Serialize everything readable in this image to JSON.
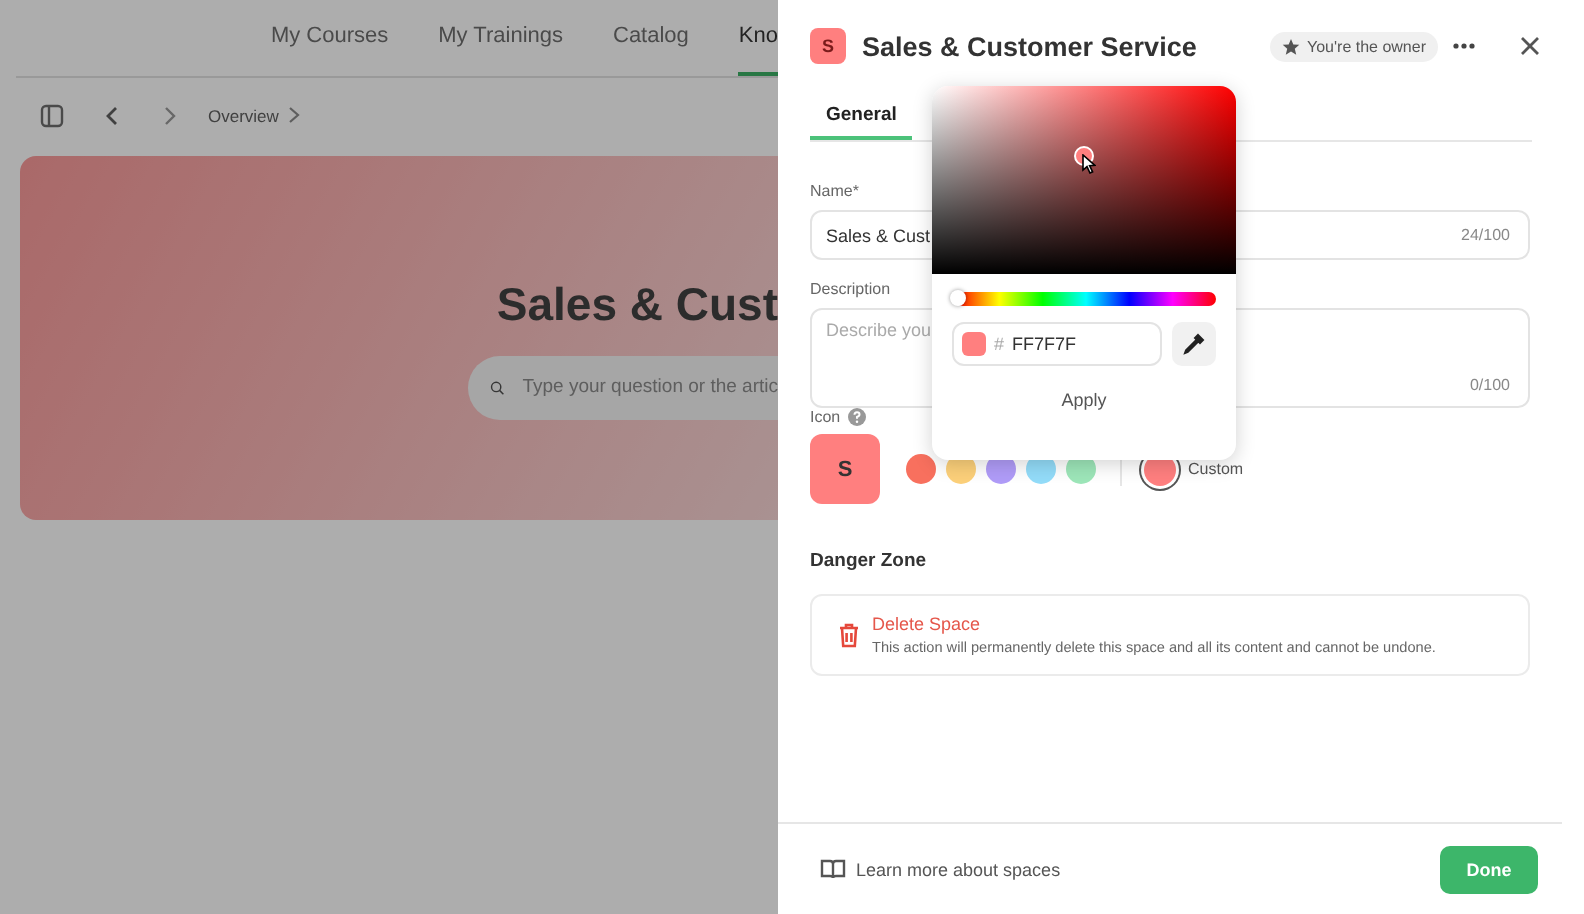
{
  "nav": {
    "tabs": [
      {
        "label": "My Courses",
        "selected": false
      },
      {
        "label": "My Trainings",
        "selected": false
      },
      {
        "label": "Catalog",
        "selected": false
      },
      {
        "label": "Kno",
        "selected": true
      }
    ]
  },
  "breadcrumb": {
    "items": [
      "Overview"
    ]
  },
  "hero": {
    "title": "Sales & Cust",
    "search": {
      "placeholder": "Type your question or the artic"
    }
  },
  "panel": {
    "title": "Sales & Customer Service",
    "icon_letter": "S",
    "owner_badge": "You're the owner",
    "tabs": [
      {
        "label": "General",
        "selected": true
      }
    ],
    "form": {
      "name": {
        "label": "Name*",
        "value": "Sales & Cust",
        "counter": "24/100"
      },
      "description": {
        "label": "Description",
        "placeholder": "Describe you",
        "counter": "0/100"
      },
      "icon": {
        "label": "Icon",
        "letter": "S",
        "swatches": [
          {
            "color": "#f8705e",
            "selected": false
          },
          {
            "color": "#fcd07a",
            "selected": false
          },
          {
            "color": "#b09cf8",
            "selected": false
          },
          {
            "color": "#93dcf9",
            "selected": false
          },
          {
            "color": "#9de6b9",
            "selected": false
          }
        ],
        "custom": {
          "label": "Custom",
          "selected": true
        }
      }
    },
    "danger_zone": {
      "title": "Danger Zone",
      "action": "Delete Space",
      "description": "This action will permanently delete this space and all its content and cannot be undone."
    },
    "footer": {
      "link": "Learn more about spaces",
      "done": "Done"
    }
  },
  "color_picker": {
    "hue": {
      "level": 0
    },
    "hex_prefix": "#",
    "hex": "FF7F7F",
    "apply": "Apply"
  }
}
